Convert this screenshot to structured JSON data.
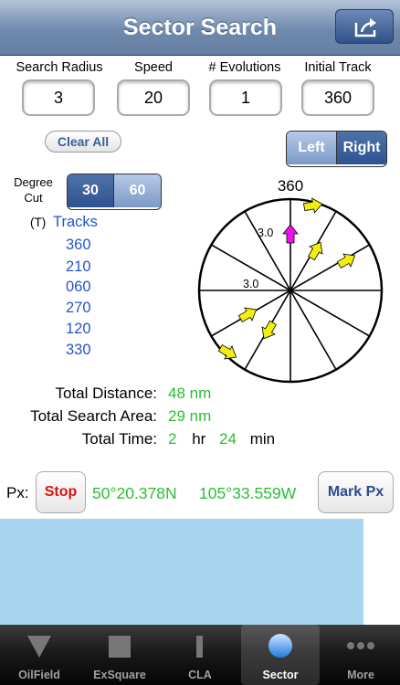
{
  "header": {
    "title": "Sector Search"
  },
  "params": [
    {
      "label": "Search Radius",
      "value": "3"
    },
    {
      "label": "Speed",
      "value": "20"
    },
    {
      "label": "# Evolutions",
      "value": "1"
    },
    {
      "label": "Initial Track",
      "value": "360"
    }
  ],
  "controls": {
    "clear_all": "Clear All",
    "left": "Left",
    "right": "Right",
    "degree_cut_label_1": "Degree",
    "degree_cut_label_2": "Cut",
    "cut_30": "30",
    "cut_60": "60"
  },
  "tracks": {
    "prefix": "(T)",
    "header": "Tracks",
    "items": [
      "360",
      "210",
      "060",
      "270",
      "120",
      "330"
    ]
  },
  "diagram": {
    "north_label": "360",
    "radius_label_top": "3.0",
    "radius_label_mid": "3.0",
    "colors": {
      "arrow": "#f2ee0e",
      "start_arrow": "#ee11ee"
    }
  },
  "totals": {
    "distance_label": "Total Distance:",
    "distance_value": "48 nm",
    "area_label": "Total Search Area:",
    "area_value": "29 nm",
    "time_label": "Total Time:",
    "time_hours": "2",
    "hr_label": "hr",
    "time_minutes": "24",
    "min_label": "min"
  },
  "position": {
    "label": "Px:",
    "stop": "Stop",
    "latitude": "50°20.378N",
    "longitude": "105°33.559W",
    "mark": "Mark Px"
  },
  "tabbar": {
    "tabs": [
      {
        "label": "OilField",
        "icon": "triangle-icon"
      },
      {
        "label": "ExSquare",
        "icon": "square-icon"
      },
      {
        "label": "CLA",
        "icon": "bar-icon"
      },
      {
        "label": "Sector",
        "icon": "sector-circle-icon"
      },
      {
        "label": "More",
        "icon": "more-dots-icon"
      }
    ],
    "active": "Sector"
  }
}
